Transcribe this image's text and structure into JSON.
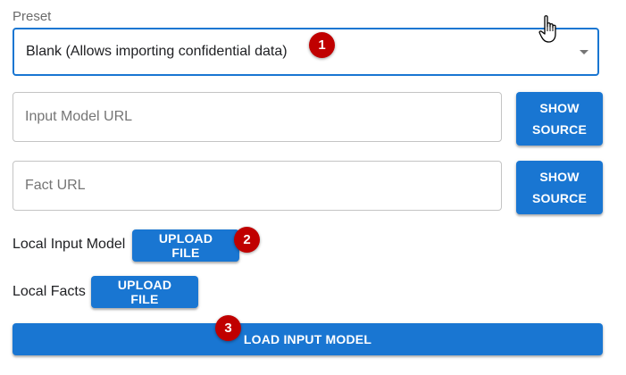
{
  "preset": {
    "label": "Preset",
    "value": "Blank (Allows importing confidential data)"
  },
  "input_model_url": {
    "placeholder": "Input Model URL",
    "value": ""
  },
  "fact_url": {
    "placeholder": "Fact URL",
    "value": ""
  },
  "show_source_label": "SHOW SOURCE",
  "local_input_model": {
    "label": "Local Input Model",
    "button": "UPLOAD FILE"
  },
  "local_facts": {
    "label": "Local Facts",
    "button": "UPLOAD FILE"
  },
  "load_button": "LOAD INPUT MODEL",
  "badges": [
    "1",
    "2",
    "3"
  ],
  "colors": {
    "primary": "#1976d2",
    "badge": "#c00000",
    "placeholder": "#757575"
  },
  "icons": {
    "cursor": "hand-pointer-icon",
    "dropdown": "dropdown-arrow-icon"
  }
}
